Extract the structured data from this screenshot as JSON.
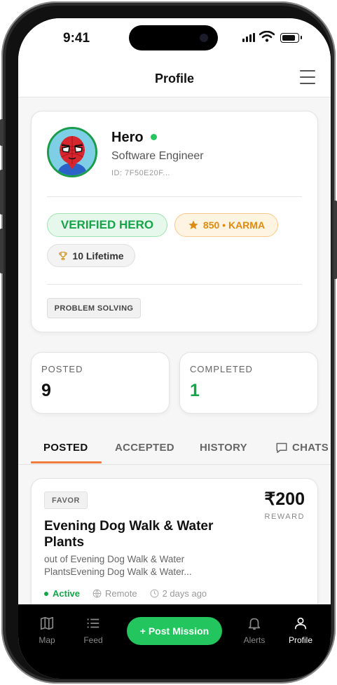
{
  "status_bar": {
    "time": "9:41"
  },
  "header": {
    "title": "Profile"
  },
  "profile": {
    "name": "Hero",
    "title": "Software Engineer",
    "id": "ID: 7F50E20F...",
    "verified_badge": "VERIFIED HERO",
    "karma_badge": "850 • KARMA",
    "lifetime_badge": "10 Lifetime",
    "skills": [
      "PROBLEM SOLVING"
    ]
  },
  "stats": [
    {
      "label": "POSTED",
      "value": "9",
      "color": "#111111"
    },
    {
      "label": "COMPLETED",
      "value": "1",
      "color": "#16a34a"
    }
  ],
  "tabs": [
    {
      "label": "POSTED",
      "active": true
    },
    {
      "label": "ACCEPTED",
      "active": false
    },
    {
      "label": "HISTORY",
      "active": false
    },
    {
      "label": "CHATS",
      "active": false
    }
  ],
  "mission": {
    "category": "FAVOR",
    "reward": "₹200",
    "reward_label": "REWARD",
    "title": "Evening Dog Walk & Water Plants",
    "description": "out of Evening Dog Walk & Water PlantsEvening Dog Walk & Water...",
    "status": "Active",
    "location": "Remote",
    "posted": "2 days ago"
  },
  "bottom_nav": {
    "items": [
      {
        "label": "Map",
        "icon": "map-icon"
      },
      {
        "label": "Feed",
        "icon": "list-icon"
      },
      {
        "label": "Alerts",
        "icon": "bell-icon"
      },
      {
        "label": "Profile",
        "icon": "user-icon",
        "active": true
      }
    ],
    "post_button": "+ Post Mission"
  },
  "colors": {
    "accent_green": "#22c55e",
    "tab_underline": "#f07c3c",
    "karma_orange": "#e08a10"
  }
}
